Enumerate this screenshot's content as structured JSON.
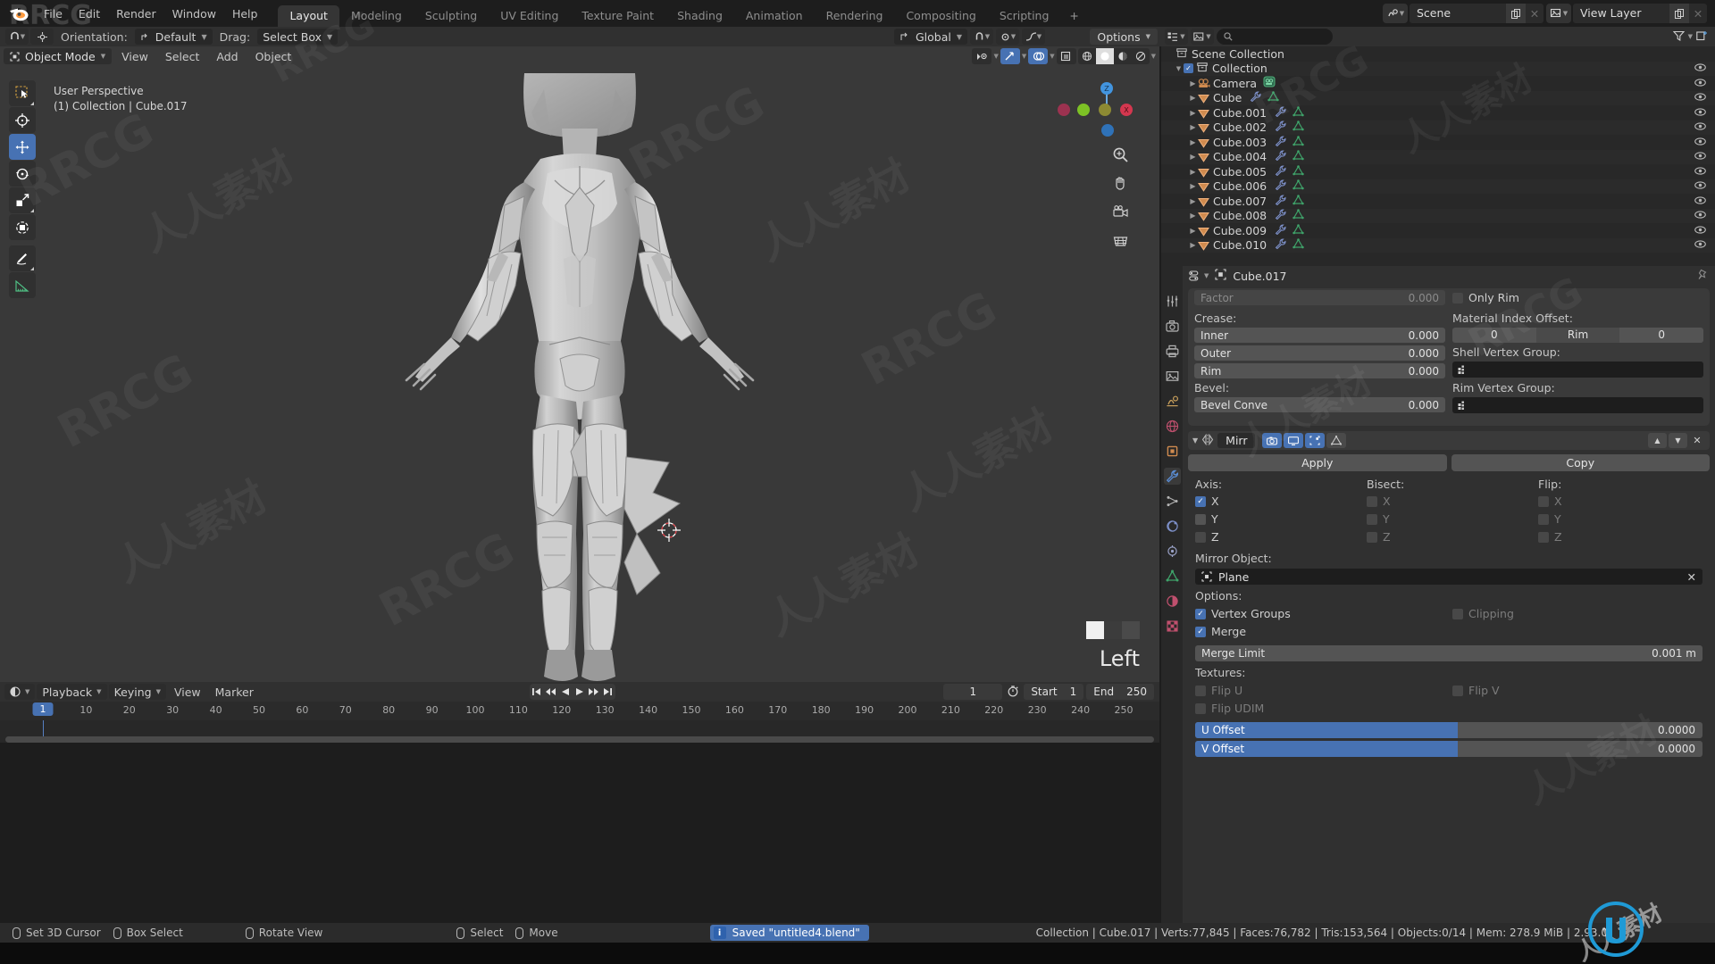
{
  "app": {
    "name": "Blender",
    "logo_icon": "blender-logo-icon"
  },
  "topbar": {
    "menus": [
      "File",
      "Edit",
      "Render",
      "Window",
      "Help"
    ],
    "tabs": [
      {
        "label": "Layout",
        "active": true
      },
      {
        "label": "Modeling",
        "active": false
      },
      {
        "label": "Sculpting",
        "active": false
      },
      {
        "label": "UV Editing",
        "active": false
      },
      {
        "label": "Texture Paint",
        "active": false
      },
      {
        "label": "Shading",
        "active": false
      },
      {
        "label": "Animation",
        "active": false
      },
      {
        "label": "Rendering",
        "active": false
      },
      {
        "label": "Compositing",
        "active": false
      },
      {
        "label": "Scripting",
        "active": false
      }
    ],
    "add_workspace": "+",
    "scene_name": "Scene",
    "view_layer_name": "View Layer",
    "scene_icon": "scene-icon",
    "view_layer_icon": "view-layer-icon",
    "duplicate_icon": "duplicate-icon",
    "close_icon": "close-icon"
  },
  "toolsettings": {
    "orientation_label": "Orientation:",
    "orientation_value": "Default",
    "drag_label": "Drag:",
    "drag_value": "Select Box",
    "transform_label": "Global",
    "options_label": "Options",
    "snap_icon": "magnet-icon",
    "proportional_icon": "proportional-edit-icon"
  },
  "viewport": {
    "mode": "Object Mode",
    "menus": [
      "View",
      "Select",
      "Add",
      "Object"
    ],
    "perspective_label": "User Perspective",
    "object_path": "(1) Collection | Cube.017",
    "axis_label": "Left",
    "tools": [
      {
        "name": "tweak-tool",
        "icon": "cursor-select-icon",
        "active": false
      },
      {
        "name": "cursor-tool",
        "icon": "3d-cursor-icon",
        "active": false
      },
      {
        "name": "move-tool",
        "icon": "move-icon",
        "active": true
      },
      {
        "name": "rotate-tool",
        "icon": "rotate-icon",
        "active": false
      },
      {
        "name": "scale-tool",
        "icon": "scale-icon",
        "active": false
      },
      {
        "name": "transform-tool",
        "icon": "transform-icon",
        "active": false
      },
      {
        "name": "annotate-tool",
        "icon": "annotate-pencil-icon",
        "active": false
      },
      {
        "name": "measure-tool",
        "icon": "measure-ruler-icon",
        "active": false
      }
    ],
    "header_icons": [
      {
        "name": "visibility-icon",
        "active": false
      },
      {
        "name": "gizmo-icon",
        "active": true
      },
      {
        "name": "overlays-icon",
        "active": true
      },
      {
        "name": "xray-icon",
        "active": false
      }
    ],
    "shading_modes": [
      {
        "name": "wireframe",
        "active": false
      },
      {
        "name": "solid",
        "active": true
      },
      {
        "name": "material-preview",
        "active": false
      },
      {
        "name": "rendered",
        "active": false
      }
    ],
    "nav_icons": [
      "zoom-icon",
      "hand-pan-icon",
      "camera-view-icon",
      "ortho-persp-icon"
    ],
    "gizmo_axes": [
      "Z",
      "Y",
      "X"
    ]
  },
  "outliner": {
    "display_mode_icon": "outliner-display-icon",
    "view_layer_icon": "view-layer-icon",
    "search_placeholder": "",
    "filter_icon": "filter-icon",
    "new_collection_icon": "new-collection-icon",
    "root": "Scene Collection",
    "collection": "Collection",
    "items": [
      {
        "label": "Camera",
        "icon": "camera-object-icon",
        "has_modifier": false,
        "has_mesh": true,
        "indent": 2
      },
      {
        "label": "Cube",
        "icon": "mesh-object-icon",
        "has_modifier": true,
        "has_mesh": true,
        "indent": 2
      },
      {
        "label": "Cube.001",
        "icon": "mesh-object-icon",
        "has_modifier": true,
        "has_mesh": true,
        "indent": 2
      },
      {
        "label": "Cube.002",
        "icon": "mesh-object-icon",
        "has_modifier": true,
        "has_mesh": true,
        "indent": 2
      },
      {
        "label": "Cube.003",
        "icon": "mesh-object-icon",
        "has_modifier": true,
        "has_mesh": true,
        "indent": 2
      },
      {
        "label": "Cube.004",
        "icon": "mesh-object-icon",
        "has_modifier": true,
        "has_mesh": true,
        "indent": 2
      },
      {
        "label": "Cube.005",
        "icon": "mesh-object-icon",
        "has_modifier": true,
        "has_mesh": true,
        "indent": 2
      },
      {
        "label": "Cube.006",
        "icon": "mesh-object-icon",
        "has_modifier": true,
        "has_mesh": true,
        "indent": 2
      },
      {
        "label": "Cube.007",
        "icon": "mesh-object-icon",
        "has_modifier": true,
        "has_mesh": true,
        "indent": 2
      },
      {
        "label": "Cube.008",
        "icon": "mesh-object-icon",
        "has_modifier": true,
        "has_mesh": true,
        "indent": 2
      },
      {
        "label": "Cube.009",
        "icon": "mesh-object-icon",
        "has_modifier": true,
        "has_mesh": true,
        "indent": 2
      },
      {
        "label": "Cube.010",
        "icon": "mesh-object-icon",
        "has_modifier": true,
        "has_mesh": true,
        "indent": 2
      }
    ]
  },
  "properties": {
    "breadcrumb_object": "Cube.017",
    "editor_icon": "properties-editor-icon",
    "object_icon": "object-data-icon",
    "pin_icon": "pin-icon",
    "tabs": [
      {
        "name": "tool",
        "icon": "tool-icon",
        "active": false
      },
      {
        "name": "render",
        "icon": "render-camera-icon",
        "active": false
      },
      {
        "name": "output",
        "icon": "printer-output-icon",
        "active": false
      },
      {
        "name": "view-layer",
        "icon": "images-viewlayer-icon",
        "active": false
      },
      {
        "name": "scene",
        "icon": "scene-cone-icon",
        "active": false
      },
      {
        "name": "world",
        "icon": "world-globe-icon",
        "active": false
      },
      {
        "name": "object",
        "icon": "object-square-icon",
        "active": false
      },
      {
        "name": "modifiers",
        "icon": "wrench-icon",
        "active": true
      },
      {
        "name": "particles",
        "icon": "particles-icon",
        "active": false
      },
      {
        "name": "physics",
        "icon": "physics-orbit-icon",
        "active": false
      },
      {
        "name": "constraints",
        "icon": "constraint-icon",
        "active": false
      },
      {
        "name": "data",
        "icon": "mesh-data-icon",
        "active": false
      },
      {
        "name": "material",
        "icon": "material-sphere-icon",
        "active": false
      },
      {
        "name": "texture",
        "icon": "texture-checker-icon",
        "active": false
      }
    ],
    "solidify": {
      "factor_label": "Factor",
      "factor_value": "0.000",
      "only_rim_label": "Only Rim",
      "only_rim_checked": false,
      "crease_label": "Crease:",
      "crease": [
        {
          "label": "Inner",
          "value": "0.000"
        },
        {
          "label": "Outer",
          "value": "0.000"
        },
        {
          "label": "Rim",
          "value": "0.000"
        }
      ],
      "material_index_label": "Material Index Offset:",
      "material_index_value": "0",
      "rim_label": "Rim",
      "rim_value": "0",
      "shell_vertex_group_label": "Shell Vertex Group:",
      "rim_vertex_group_label": "Rim Vertex Group:",
      "bevel_label": "Bevel:",
      "bevel_convex_label": "Bevel Conve",
      "bevel_convex_value": "0.000"
    },
    "mirror": {
      "name": "Mirr",
      "modifier_icon": "mirror-modifier-icon",
      "display_toggles": [
        {
          "name": "render-toggle",
          "icon": "camera-icon",
          "on": true
        },
        {
          "name": "realtime-toggle",
          "icon": "monitor-icon",
          "on": true
        },
        {
          "name": "edit-mode-toggle",
          "icon": "editmode-icon",
          "on": true
        },
        {
          "name": "on-cage-toggle",
          "icon": "cage-icon",
          "on": false
        }
      ],
      "move_up_icon": "arrow-up-icon",
      "move_down_icon": "arrow-down-icon",
      "delete_icon": "x-icon",
      "apply_label": "Apply",
      "copy_label": "Copy",
      "axis_label": "Axis:",
      "bisect_label": "Bisect:",
      "flip_label": "Flip:",
      "axis": [
        {
          "label": "X",
          "checked": true
        },
        {
          "label": "Y",
          "checked": false
        },
        {
          "label": "Z",
          "checked": false
        }
      ],
      "bisect": [
        {
          "label": "X",
          "checked": false
        },
        {
          "label": "Y",
          "checked": false
        },
        {
          "label": "Z",
          "checked": false
        }
      ],
      "flip": [
        {
          "label": "X",
          "checked": false
        },
        {
          "label": "Y",
          "checked": false
        },
        {
          "label": "Z",
          "checked": false
        }
      ],
      "mirror_object_label": "Mirror Object:",
      "mirror_object_value": "Plane",
      "options_label": "Options:",
      "vertex_groups_label": "Vertex Groups",
      "vertex_groups_checked": true,
      "clipping_label": "Clipping",
      "clipping_checked": false,
      "merge_label": "Merge",
      "merge_checked": true,
      "merge_limit_label": "Merge Limit",
      "merge_limit_value": "0.001 m",
      "textures_label": "Textures:",
      "flip_u_label": "Flip U",
      "flip_u_checked": false,
      "flip_v_label": "Flip V",
      "flip_v_checked": false,
      "flip_udim_label": "Flip UDIM",
      "flip_udim_checked": false,
      "u_offset_label": "U Offset",
      "u_offset_value": "0.0000",
      "v_offset_label": "V Offset",
      "v_offset_value": "0.0000"
    }
  },
  "timeline": {
    "editor_icon": "timeline-editor-icon",
    "menus": [
      "Playback",
      "Keying",
      "View",
      "Marker"
    ],
    "playback_buttons": [
      {
        "name": "jump-to-start-button",
        "icon": "skip-start-icon"
      },
      {
        "name": "previous-keyframe-button",
        "icon": "prev-keyframe-icon"
      },
      {
        "name": "play-reverse-button",
        "icon": "play-reverse-icon"
      },
      {
        "name": "play-button",
        "icon": "play-icon"
      },
      {
        "name": "next-keyframe-button",
        "icon": "next-keyframe-icon"
      },
      {
        "name": "jump-to-end-button",
        "icon": "skip-end-icon"
      }
    ],
    "current_frame": "1",
    "auto_key_icon": "stopwatch-icon",
    "start_label": "Start",
    "start_value": "1",
    "end_label": "End",
    "end_value": "250",
    "ticks": [
      10,
      20,
      30,
      40,
      50,
      60,
      70,
      80,
      90,
      100,
      110,
      120,
      130,
      140,
      150,
      160,
      170,
      180,
      190,
      200,
      210,
      220,
      230,
      240,
      250
    ]
  },
  "statusbar": {
    "hints": [
      {
        "icon": "mouse-left-icon",
        "label": "Set 3D Cursor"
      },
      {
        "icon": "mouse-left-drag-icon",
        "label": "Box Select"
      },
      {
        "icon": "mouse-middle-icon",
        "label": "Rotate View"
      },
      {
        "icon": "mouse-right-icon",
        "label": "Select"
      },
      {
        "icon": "mouse-right-drag-icon",
        "label": "Move"
      }
    ],
    "saved_message": "Saved \"untitled4.blend\"",
    "info_icon": "info-icon",
    "stats": "Collection | Cube.017 | Verts:77,845 | Faces:76,782 | Tris:153,564 | Objects:0/14 | Mem: 278.9 MiB | 2.93.0"
  },
  "watermarks": {
    "brand": "RRCG",
    "cn_text": "人人素材"
  },
  "colors": {
    "accent_blue": "#4772b3",
    "bg_dark": "#1d1d1d",
    "bg_panel": "#303030",
    "viewport_bg": "#393939",
    "outliner_bg": "#282828",
    "mesh_green": "#3fa36a",
    "object_orange": "#d08b4f"
  }
}
